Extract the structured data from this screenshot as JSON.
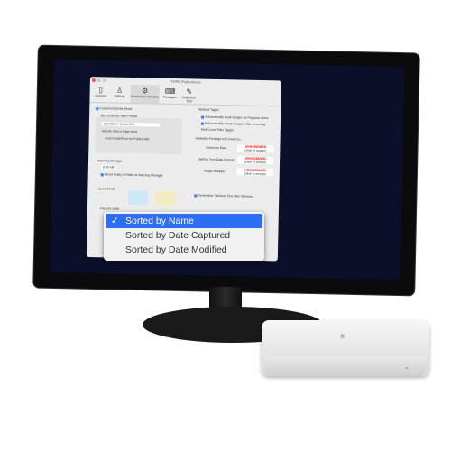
{
  "window": {
    "title": "TCPS Preferences",
    "toolbar": [
      {
        "label": "General",
        "icon": "document-icon"
      },
      {
        "label": "Writing",
        "icon": "figure-icon"
      },
      {
        "label": "Destination Window",
        "icon": "gear-icon"
      },
      {
        "label": "Packages",
        "icon": "keyboard-icon"
      },
      {
        "label": "Collection Tool",
        "icon": "pencil-icon"
      }
    ],
    "left": {
      "customize": "Customize Order Mode",
      "sort_header": "Sort Order for New Photos",
      "sort_select": "Sort Order Sorted first",
      "opt1": "Include dots in Digit input",
      "opt2": "Insert Date/Time for Folder with",
      "warning": "Warning Midnight",
      "time": "9:00 AM",
      "warn_opt": "Reset Today's Folder at Warning Midnight",
      "layout": "Layout Mode",
      "sort_label": "File sort order"
    },
    "right": {
      "header": "Method Tag(s)",
      "opt1": "Automatically mark images as Pegasus items",
      "opt2": "Automatically create images after renaming",
      "opt3": "Max Count Files Tag(s)",
      "pkg_header": "Available Package to Convert to...",
      "rows": [
        {
          "label": "Return to Main",
          "status": "UNASSIGNED",
          "sub": "(click to assign)"
        },
        {
          "label": "Setting Your Date Format",
          "status": "UNASSIGNED",
          "sub": "(click to assign)"
        },
        {
          "label": "Image Wrapper",
          "status": "UNASSIGNED",
          "sub": "(click to assign)"
        }
      ],
      "bottom_opt": "Remember Tab/Item Text After Window"
    }
  },
  "dropdown": {
    "options": [
      "Sorted by Name",
      "Sorted by Date Captured",
      "Sorted by Date Modified"
    ],
    "selected": "Sorted by Name",
    "check": "✓"
  },
  "mac_mini": {
    "logo": ""
  }
}
